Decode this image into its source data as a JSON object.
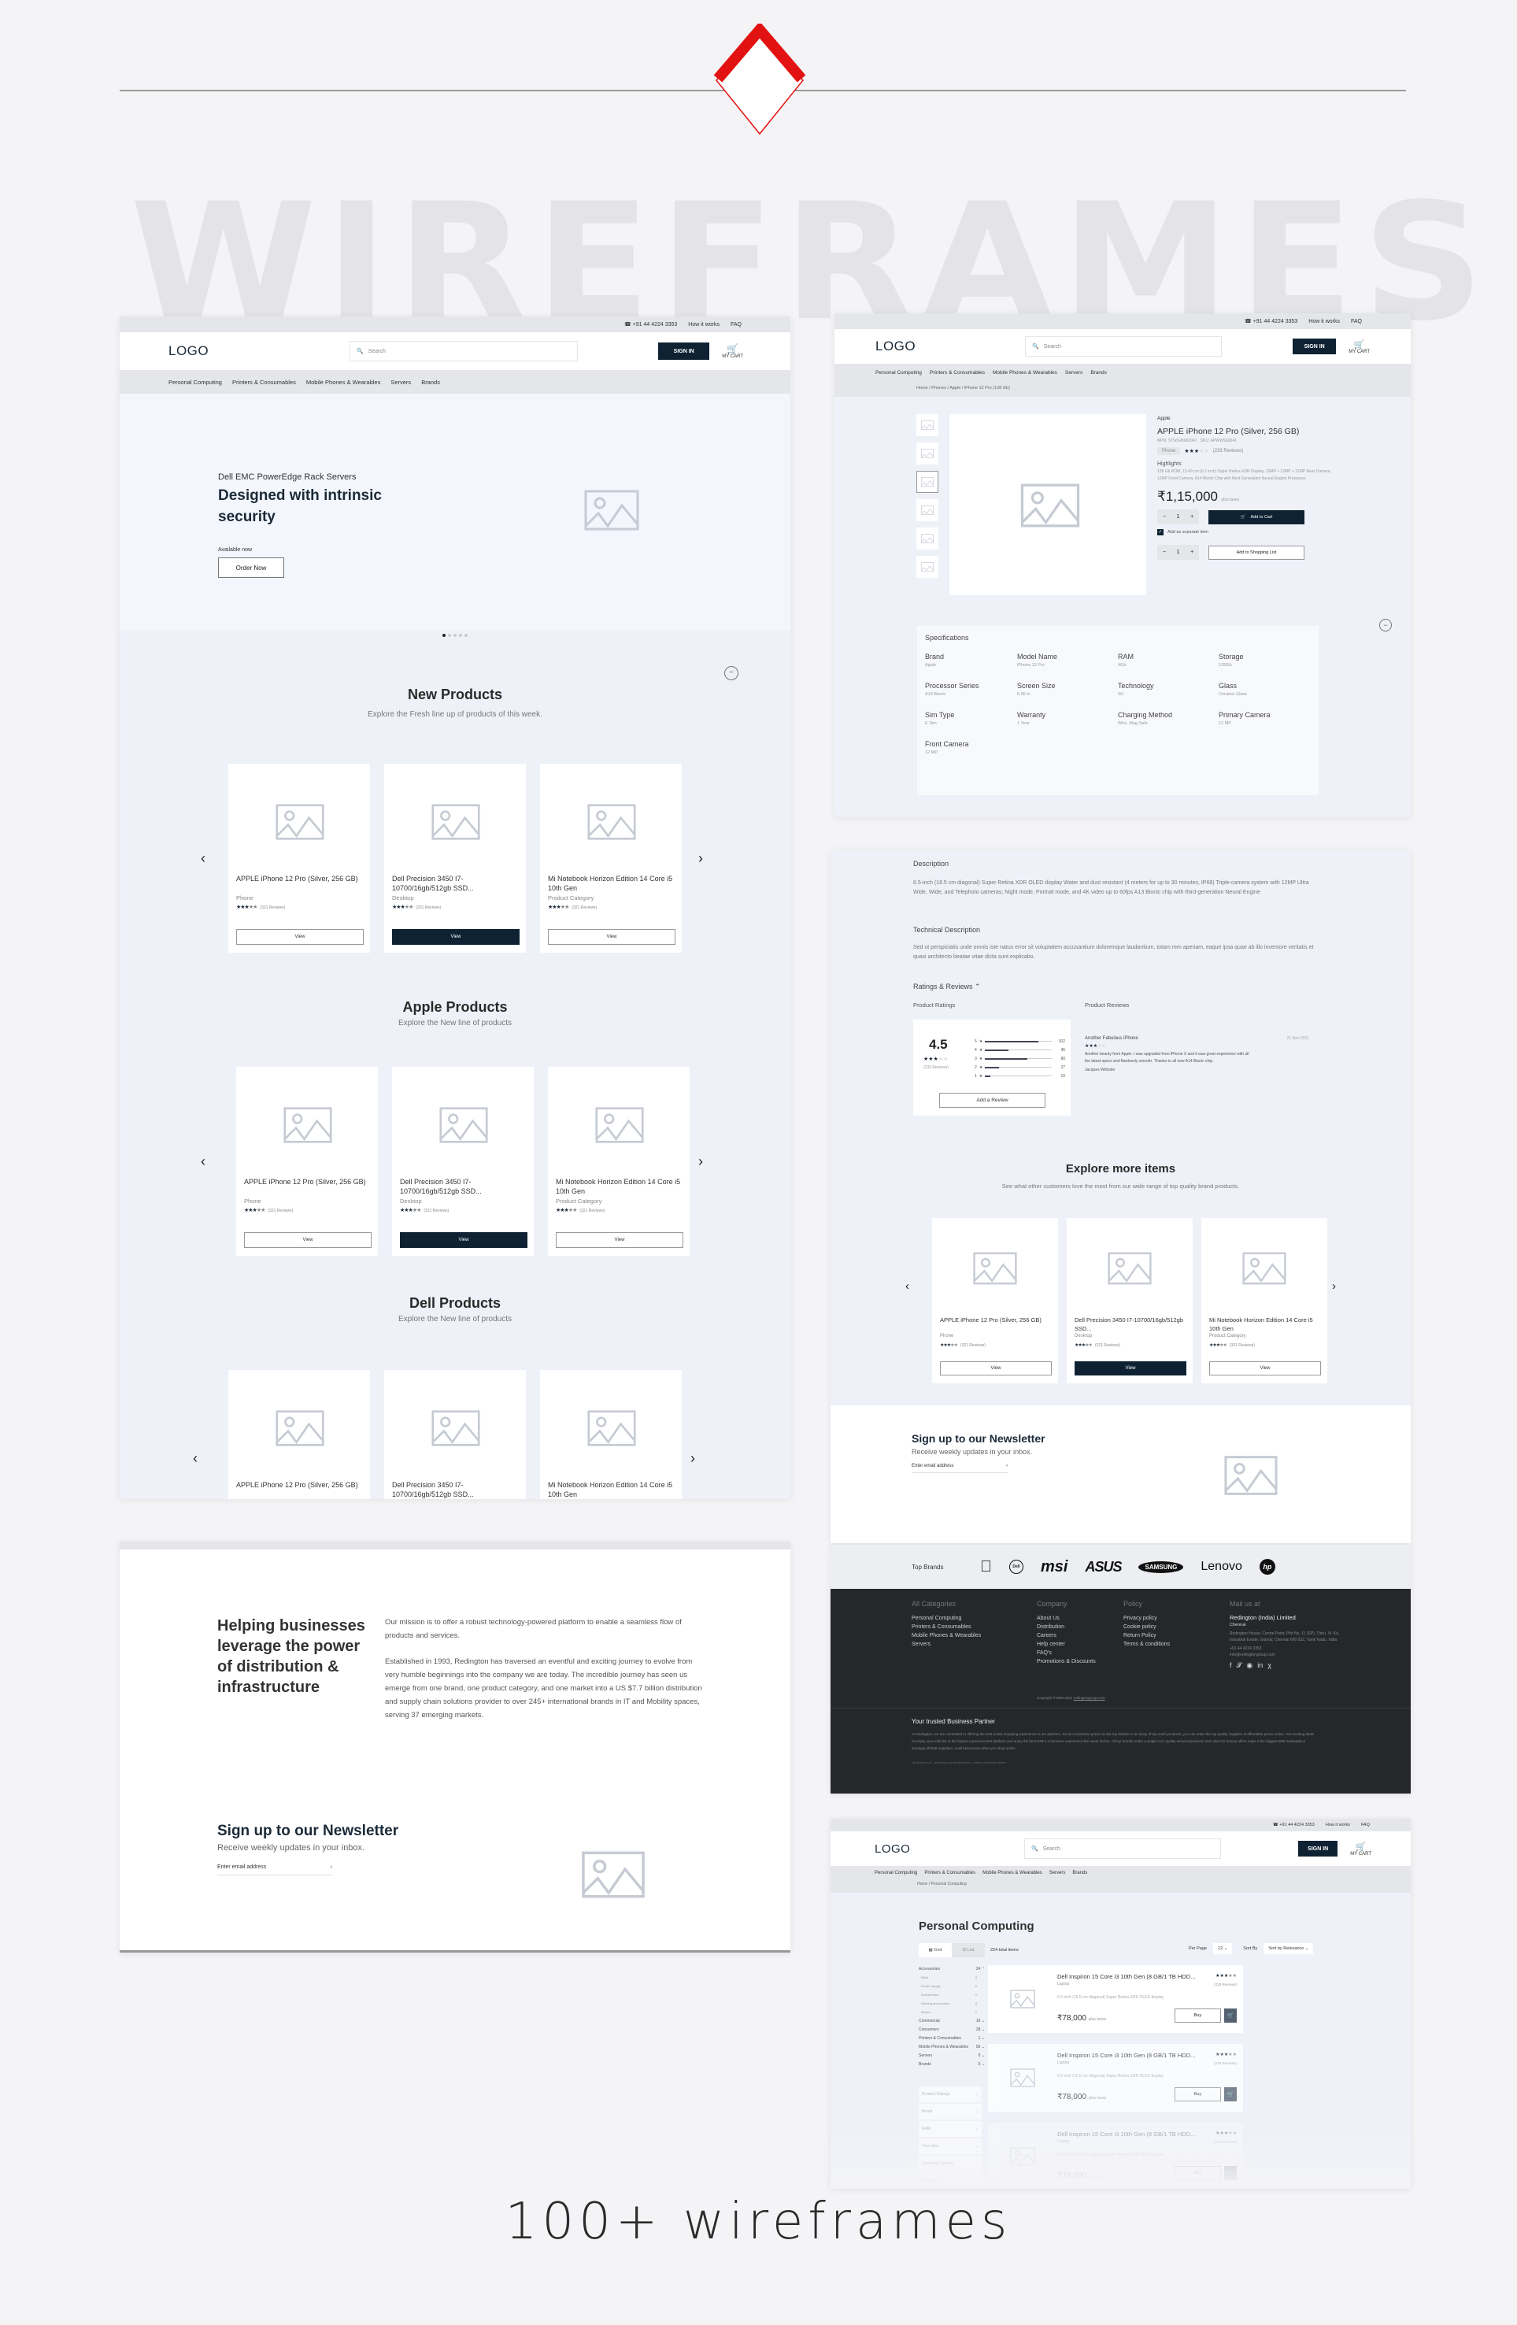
{
  "showcase": {
    "watermark": "WIREFRAMES",
    "caption": "100+ wireframes",
    "accent_color": "#e31212"
  },
  "header": {
    "phone": "+91 44 4224 3353",
    "how_it_works": "How it works",
    "faq": "FAQ",
    "logo": "LOGO",
    "search_placeholder": "Search",
    "sign_in": "SIGN IN",
    "cart": "MY CART",
    "nav": [
      "Personal Computing",
      "Printers & Consumables",
      "Mobile Phones & Wearables",
      "Servers",
      "Brands"
    ]
  },
  "home": {
    "hero": {
      "eyebrow": "Dell EMC PowerEdge Rack Servers",
      "title": "Designed with intrinsic security",
      "availability": "Available now",
      "cta": "Order Now",
      "slides_total": 5,
      "slide_active": 1
    },
    "sections": [
      {
        "title": "New Products",
        "subtitle": "Explore the Fresh line up of products of this week."
      },
      {
        "title": "Apple Products",
        "subtitle": "Explore the New line of products"
      },
      {
        "title": "Dell Products",
        "subtitle": "Explore the New line of products"
      }
    ],
    "products": [
      {
        "name": "APPLE iPhone 12 Pro (Silver, 256 GB)",
        "category": "Phone",
        "reviews": "(321 Reviews)",
        "rating": 3,
        "button": "View"
      },
      {
        "name": "Dell Precision 3450 I7-10700/16gb/512gb SSD...",
        "category": "Desktop",
        "reviews": "(321 Reviews)",
        "rating": 3,
        "button": "View"
      },
      {
        "name": "Mi Notebook Horizon Edition 14  Core i5 10th Gen",
        "category": "Product Category",
        "reviews": "(321 Reviews)",
        "rating": 3,
        "button": "View"
      }
    ],
    "about": {
      "title": "Helping businesses leverage the power of distribution & infrastructure",
      "para1": "Our mission is to offer a robust technology-powered platform to enable a seamless flow of products and services.",
      "para2": "Established in 1993, Redington has traversed an eventful and exciting journey to evolve from very humble beginnings into the company we are today. The incredible journey has seen us emerge from one brand, one product category, and one market into a US $7.7 billion distribution and supply chain solutions provider to over 245+ international brands in IT and Mobility spaces, serving 37 emerging markets."
    },
    "newsletter": {
      "title": "Sign up to our Newsletter",
      "subtitle": "Receive weekly updates in your inbox.",
      "placeholder": "Enter email address"
    }
  },
  "pdp": {
    "breadcrumb": "Home / Phones / Apple / iPhone 12 Pro (128 Gb)",
    "brand": "Apple",
    "title": "APPLE iPhone 12 Pro (Silver, 256 GB)",
    "mpn": "MPN: STWS45660041",
    "sku": "SKU: APWWS60041",
    "tag": "Phone",
    "rating": 3,
    "reviews": "(233 Reviews)",
    "highlights_label": "Highlights",
    "highlights": "128 Gb ROM, 15.49 cm (6.1 inch) Super Retina XDR Display, 12MP + 12MP + 12MP Rear Camera, 12MP Front Camera, A14 Bionic Chip with Next Generation Neural Engine Processor.",
    "price": "₹1,15,000",
    "price_note": "plus taxes",
    "qty": "1",
    "add_to_cart": "Add to Cart",
    "separate_item": "Add as separate item",
    "separate_item_checked": true,
    "add_to_list": "Add to Shopping List",
    "specs_title": "Specifications",
    "specs": [
      {
        "k": "Brand",
        "v": "Apple"
      },
      {
        "k": "Model Name",
        "v": "iPhone 12 Pro"
      },
      {
        "k": "RAM",
        "v": "4Gb"
      },
      {
        "k": "Storage",
        "v": "128Gb"
      },
      {
        "k": "Processor Series",
        "v": "A14 Bionic"
      },
      {
        "k": "Screen Size",
        "v": "6.06 in"
      },
      {
        "k": "Technology",
        "v": "5G"
      },
      {
        "k": "Glass",
        "v": "Ceramic Glass"
      },
      {
        "k": "Sim Type",
        "v": "E Sim"
      },
      {
        "k": "Warranty",
        "v": "1 Year"
      },
      {
        "k": "Charging Method",
        "v": "Wire, Mag Safe"
      },
      {
        "k": "Primary Camera",
        "v": "12 MP"
      },
      {
        "k": "Front Camera",
        "v": "12 MP"
      }
    ],
    "description_title": "Description",
    "description": "6.5-inch (16.5 cm diagonal) Super Retina XDR OLED display Water and dust resistant (4 meters for up to 30 minutes, IP68) Triple-camera system with 12MP Ultra Wide, Wide, and Telephoto cameras; Night mode, Portrait mode, and 4K video up to 60fps A13 Bionic chip with third-generation Neural Engine",
    "tech_title": "Technical Description",
    "tech": "Sed ut perspiciatis unde omnis iste natus error sit voluptatem accusantium doloremque laudantium, totam rem aperiam, eaque ipsa quae ab illo inventore veritatis et quasi architecto beatae vitae dicta sunt explicabo.",
    "ratings_title": "Ratings & Reviews",
    "product_ratings": "Product Ratings",
    "product_reviews": "Product Reviews",
    "avg": "4.5",
    "avg_reviews": "(233 Reviews)",
    "breakdown": [
      {
        "star": "5",
        "count": 102
      },
      {
        "star": "4",
        "count": 45
      },
      {
        "star": "3",
        "count": 80
      },
      {
        "star": "2",
        "count": 27
      },
      {
        "star": "1",
        "count": 10
      }
    ],
    "add_review": "Add a Review",
    "review": {
      "title": "Another Fabulous iPhone",
      "date": "21 Nov 2021",
      "rating": 3,
      "body": "Another beauty from Apple. I was upgraded from iPhone X and it was great experience with all the latest specs and flawlessly smooth. Thanks to all new A14 Bionic chip.",
      "author": "Jacques Webster"
    },
    "explore_title": "Explore more items",
    "explore_sub": "See what other customers love the most from our wide range of top quality brand products."
  },
  "footer": {
    "top_brands": "Top Brands",
    "brands": [
      "Apple",
      "Dell",
      "msi",
      "ASUS",
      "SAMSUNG",
      "Lenovo",
      "hp"
    ],
    "cols": [
      {
        "title": "All Categories",
        "items": [
          "Personal Computing",
          "Printers & Consumables",
          "Mobile Phones & Wearables",
          "Servers"
        ]
      },
      {
        "title": "Company",
        "items": [
          "About Us",
          "Distribution",
          "Careers",
          "Help center",
          "FAQ's",
          "Promotions & Discounts"
        ]
      },
      {
        "title": "Policy",
        "items": [
          "Privacy policy",
          "Cookie policy",
          "Return Policy",
          "Terms & conditions"
        ]
      }
    ],
    "mail_title": "Mail us at",
    "company": "Redington (India) Limited",
    "city": "Chennai",
    "address": "Redington House, Centre Point, Plot No. 11 (SP), Thiru. Vi. Ka. Industrial Estate, Guindy, Chennai 600 032, Tamil Nadu, India",
    "phone": "+91 44 4224 3353",
    "email": "info@redingtongroup.com",
    "copyright": "Copyright ©1993-2021",
    "copyright_link": "redingtongroup.com",
    "partner_title": "Your trusted Business Partner",
    "partner_text": "At Redington, we are committed to offering the best online shopping experience to our partners. So be it exclusive prices on the top brands or an array of top notch products, you can order the top quality Supplies at affordable prices online. Get exciting deals to empty your wish-list at the largest e-procurement platform and enjoy the best B2B e-commerce experience like never before. All top brands under a single roof, quality assured products and value for money offers make it the biggest B2B marketplace amongst all B2B suppliers. Avail best prices when you shop online.",
    "disclaimer": "*All prices excl. shipping and handling fees, unless otherwise stated."
  },
  "plp": {
    "breadcrumb": "Home / Personal Computing",
    "title": "Personal Computing",
    "view_grid": "Grid",
    "view_list": "List",
    "total": "224 total items",
    "per_page_label": "Per Page",
    "per_page": "12",
    "sort_label": "Sort By",
    "sort": "Sort by Relevance",
    "filters": [
      {
        "name": "Accessories",
        "count": "24",
        "open": true
      },
      {
        "name": "Commercial",
        "count": "16"
      },
      {
        "name": "Consumers",
        "count": "28"
      },
      {
        "name": "Printers & Consumables",
        "count": "1"
      },
      {
        "name": "Mobile Phones & Wearables",
        "count": "59"
      },
      {
        "name": "Servers",
        "count": "0"
      },
      {
        "name": "Brands",
        "count": "0"
      }
    ],
    "subfilters": [
      {
        "name": "RAM",
        "count": "8"
      },
      {
        "name": "Power Supply",
        "count": "6"
      },
      {
        "name": "Motherboard",
        "count": "0"
      },
      {
        "name": "Gaming accessories",
        "count": "8"
      },
      {
        "name": "Mouse",
        "count": "2"
      }
    ],
    "facets": [
      "Product Ratings",
      "Brand",
      "RAM",
      "Hard disk",
      "Operating System",
      "Processor"
    ],
    "item": {
      "name": "Dell Inspiron 15 Core i3 10th Gen (8 GB/1 TB HDD...",
      "category": "Laptop",
      "desc": "6.5-inch (16.5 cm diagonal) Super Retina XDR OLED display",
      "price": "₹78,000",
      "price_note": "plus taxes",
      "reviews": "(233 Reviews)",
      "buy": "Buy"
    }
  }
}
